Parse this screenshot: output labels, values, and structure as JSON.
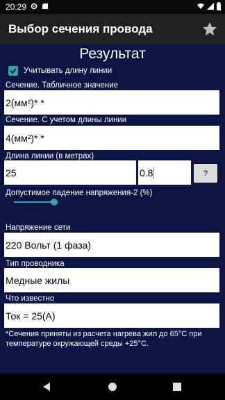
{
  "status_bar": {
    "time": "20:29"
  },
  "app_bar": {
    "title": "Выбор сечения провода"
  },
  "main": {
    "heading": "Результат",
    "checkbox_label": "Учитывать длину линии",
    "section_table_label": "Сечение. Табличное значение",
    "section_table_value": "2(мм²)* *",
    "section_length_label": "Сечение. С учетом длины линии",
    "section_length_value": "4(мм²)* *",
    "line_length_label": "Длина линии (в метрах)",
    "line_length_value": "25",
    "coefficient_value": "0.8",
    "help_button": "?",
    "voltage_drop_label": "Допустимое падение напряжения-2 (%)",
    "voltage_drop_slider_value": 2,
    "network_voltage_label": "Напряжение сети",
    "network_voltage_value": "220 Вольт (1 фаза)",
    "conductor_type_label": "Тип проводника",
    "conductor_type_value": "Медные жилы",
    "known_label": "Что известно",
    "known_value": "Ток = 25(А)",
    "footnote": "*Сечения приняты из расчета нагрева жил до 65°С при температуре окружающей среды +25°С."
  },
  "colors": {
    "accent": "#2ea8a4",
    "background": "#0c1442",
    "appbar": "#212121"
  },
  "icons": [
    "signal-settings-icon",
    "sd-card-icon",
    "wifi-icon",
    "signal-icon",
    "battery-icon",
    "star-icon",
    "back-icon",
    "home-icon",
    "recents-icon"
  ]
}
